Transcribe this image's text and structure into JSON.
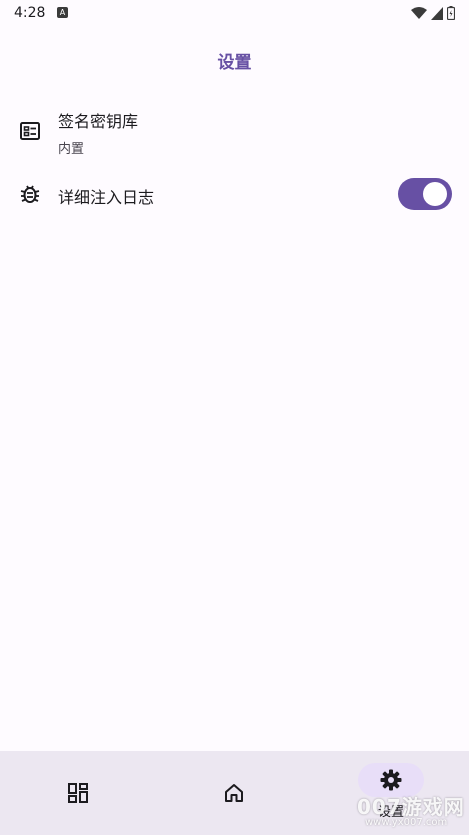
{
  "status_bar": {
    "time": "4:28",
    "notification_glyph": "A",
    "icons": [
      "wifi-icon",
      "signal-icon",
      "battery-icon"
    ]
  },
  "app_bar": {
    "title": "设置"
  },
  "settings": {
    "keystore": {
      "title": "签名密钥库",
      "subtitle": "内置",
      "icon": "keystore-card-icon"
    },
    "verbose_log": {
      "title": "详细注入日志",
      "icon": "bug-icon",
      "enabled": true
    }
  },
  "bottom_nav": {
    "items": [
      {
        "icon": "apps-grid-icon",
        "label": ""
      },
      {
        "icon": "home-icon",
        "label": ""
      },
      {
        "icon": "gear-icon",
        "label": "设置",
        "selected": true
      }
    ]
  },
  "watermark": {
    "text": "007游戏网",
    "url": "www.yx007.com"
  },
  "colors": {
    "accent": "#6750a4",
    "nav_bg": "#ece7f1",
    "nav_pill": "#e8def8",
    "background": "#fefbff"
  }
}
